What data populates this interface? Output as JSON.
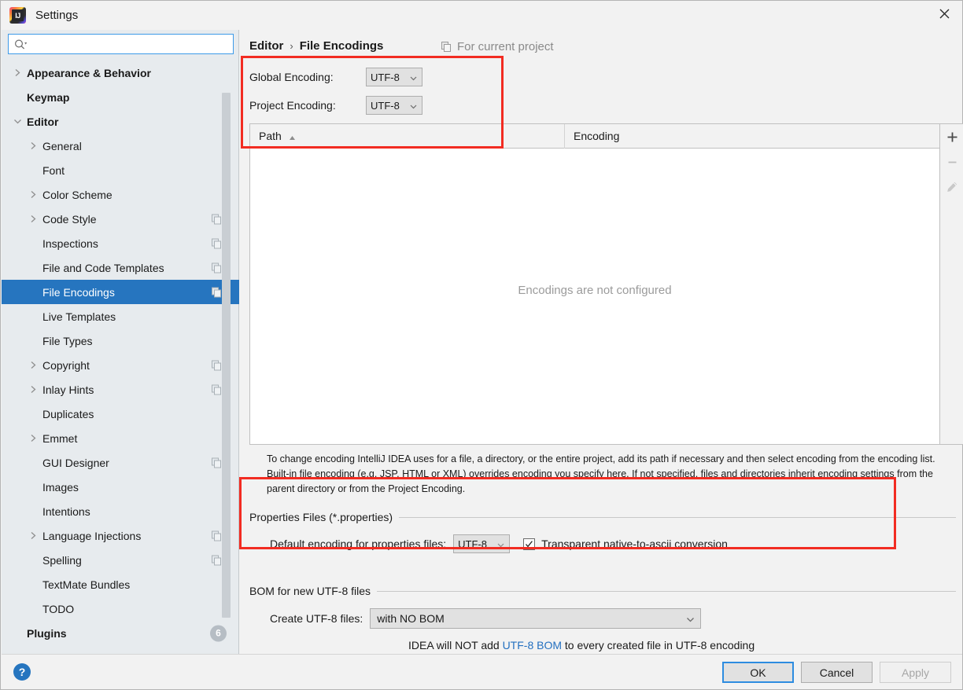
{
  "window": {
    "title": "Settings",
    "logo_text": "IJ",
    "close_icon": "close-icon"
  },
  "sidebar": {
    "search": {
      "value": "",
      "placeholder": "",
      "icon": "search-icon"
    },
    "items": [
      {
        "label": "Appearance & Behavior",
        "arrow": "right",
        "bold": true,
        "selected": false,
        "copy": false,
        "count": null
      },
      {
        "label": "Keymap",
        "arrow": "none",
        "bold": true,
        "selected": false,
        "copy": false,
        "count": null
      },
      {
        "label": "Editor",
        "arrow": "down",
        "bold": true,
        "selected": false,
        "copy": false,
        "count": null
      },
      {
        "label": "General",
        "arrow": "right",
        "bold": false,
        "selected": false,
        "copy": false,
        "count": null,
        "indent": 1
      },
      {
        "label": "Font",
        "arrow": "none",
        "bold": false,
        "selected": false,
        "copy": false,
        "count": null,
        "indent": 1
      },
      {
        "label": "Color Scheme",
        "arrow": "right",
        "bold": false,
        "selected": false,
        "copy": false,
        "count": null,
        "indent": 1
      },
      {
        "label": "Code Style",
        "arrow": "right",
        "bold": false,
        "selected": false,
        "copy": true,
        "count": null,
        "indent": 1
      },
      {
        "label": "Inspections",
        "arrow": "none",
        "bold": false,
        "selected": false,
        "copy": true,
        "count": null,
        "indent": 1
      },
      {
        "label": "File and Code Templates",
        "arrow": "none",
        "bold": false,
        "selected": false,
        "copy": true,
        "count": null,
        "indent": 1
      },
      {
        "label": "File Encodings",
        "arrow": "none",
        "bold": false,
        "selected": true,
        "copy": true,
        "count": null,
        "indent": 1
      },
      {
        "label": "Live Templates",
        "arrow": "none",
        "bold": false,
        "selected": false,
        "copy": false,
        "count": null,
        "indent": 1
      },
      {
        "label": "File Types",
        "arrow": "none",
        "bold": false,
        "selected": false,
        "copy": false,
        "count": null,
        "indent": 1
      },
      {
        "label": "Copyright",
        "arrow": "right",
        "bold": false,
        "selected": false,
        "copy": true,
        "count": null,
        "indent": 1
      },
      {
        "label": "Inlay Hints",
        "arrow": "right",
        "bold": false,
        "selected": false,
        "copy": true,
        "count": null,
        "indent": 1
      },
      {
        "label": "Duplicates",
        "arrow": "none",
        "bold": false,
        "selected": false,
        "copy": false,
        "count": null,
        "indent": 1
      },
      {
        "label": "Emmet",
        "arrow": "right",
        "bold": false,
        "selected": false,
        "copy": false,
        "count": null,
        "indent": 1
      },
      {
        "label": "GUI Designer",
        "arrow": "none",
        "bold": false,
        "selected": false,
        "copy": true,
        "count": null,
        "indent": 1
      },
      {
        "label": "Images",
        "arrow": "none",
        "bold": false,
        "selected": false,
        "copy": false,
        "count": null,
        "indent": 1
      },
      {
        "label": "Intentions",
        "arrow": "none",
        "bold": false,
        "selected": false,
        "copy": false,
        "count": null,
        "indent": 1
      },
      {
        "label": "Language Injections",
        "arrow": "right",
        "bold": false,
        "selected": false,
        "copy": true,
        "count": null,
        "indent": 1
      },
      {
        "label": "Spelling",
        "arrow": "none",
        "bold": false,
        "selected": false,
        "copy": true,
        "count": null,
        "indent": 1
      },
      {
        "label": "TextMate Bundles",
        "arrow": "none",
        "bold": false,
        "selected": false,
        "copy": false,
        "count": null,
        "indent": 1
      },
      {
        "label": "TODO",
        "arrow": "none",
        "bold": false,
        "selected": false,
        "copy": false,
        "count": null,
        "indent": 1
      },
      {
        "label": "Plugins",
        "arrow": "none",
        "bold": true,
        "selected": false,
        "copy": false,
        "count": "6"
      }
    ]
  },
  "main": {
    "breadcrumb": {
      "parent": "Editor",
      "separator": "›",
      "current": "File Encodings"
    },
    "for_current_project": {
      "label": "For current project",
      "icon": "copy-icon"
    },
    "global_encoding": {
      "label": "Global Encoding:",
      "value": "UTF-8"
    },
    "project_encoding": {
      "label": "Project Encoding:",
      "value": "UTF-8"
    },
    "table": {
      "columns": [
        "Path",
        "Encoding"
      ],
      "sort_column": "Path",
      "sort_direction": "ascending",
      "rows": [],
      "empty_message": "Encodings are not configured",
      "toolbar": [
        {
          "name": "add-button",
          "glyph": "+",
          "enabled": true
        },
        {
          "name": "remove-button",
          "glyph": "−",
          "enabled": false
        },
        {
          "name": "edit-button",
          "glyph": "pencil",
          "enabled": false
        }
      ]
    },
    "description": "To change encoding IntelliJ IDEA uses for a file, a directory, or the entire project, add its path if necessary and then select encoding from the encoding list. Built-in file encoding (e.g. JSP, HTML or XML) overrides encoding you specify here. If not specified, files and directories inherit encoding settings from the parent directory or from the Project Encoding.",
    "properties_group": {
      "title": "Properties Files (*.properties)",
      "default_encoding_label": "Default encoding for properties files:",
      "default_encoding_value": "UTF-8",
      "checkbox_label": "Transparent native-to-ascii conversion",
      "checkbox_checked": true
    },
    "bom_group": {
      "title": "BOM for new UTF-8 files",
      "create_label": "Create UTF-8 files:",
      "create_value": "with NO BOM",
      "hint_before": "IDEA will NOT add ",
      "hint_link": "UTF-8 BOM",
      "hint_after": " to every created file in UTF-8 encoding"
    }
  },
  "footer": {
    "help": "?",
    "ok": "OK",
    "cancel": "Cancel",
    "apply": "Apply",
    "apply_enabled": false
  },
  "colors": {
    "accent": "#2675bf",
    "selection": "#2675bf",
    "annotation": "#f22c22",
    "link": "#2470c0",
    "sidebar_bg": "#e7ebee",
    "panel_bg": "#f2f2f2"
  }
}
